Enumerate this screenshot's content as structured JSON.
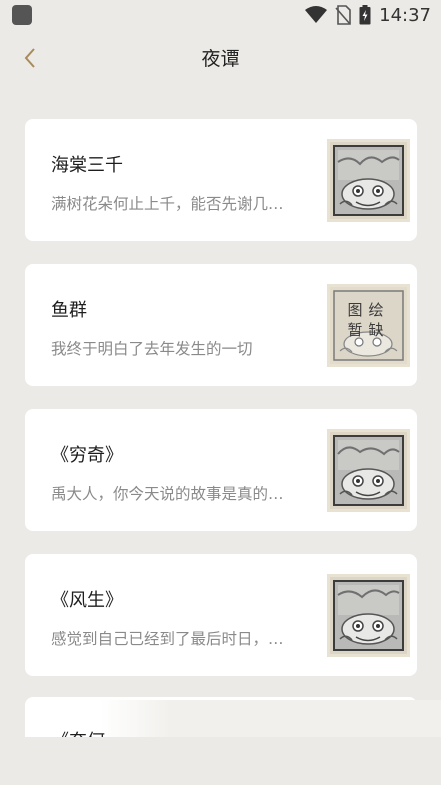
{
  "status_bar": {
    "time": "14:37"
  },
  "header": {
    "title": "夜谭"
  },
  "cards": [
    {
      "title": "海棠三千",
      "desc": "满树花朵何止上千，能否先谢几…",
      "thumb_label": ""
    },
    {
      "title": "鱼群",
      "desc": "我终于明白了去年发生的一切",
      "thumb_label": "图绘",
      "thumb_label2": "暂缺"
    },
    {
      "title": "《穷奇》",
      "desc": "禹大人，你今天说的故事是真的…",
      "thumb_label": ""
    },
    {
      "title": "《风生》",
      "desc": "感觉到自己已经到了最后时日，…",
      "thumb_label": ""
    }
  ],
  "partial_card": {
    "title": "《奈何…"
  },
  "colors": {
    "background": "#eceae6",
    "card": "#ffffff",
    "accent_back": "#a88b5a"
  },
  "icons": [
    "app-icon",
    "wifi-icon",
    "no-sim-icon",
    "battery-icon",
    "back-icon",
    "beast-illustration-icon"
  ]
}
